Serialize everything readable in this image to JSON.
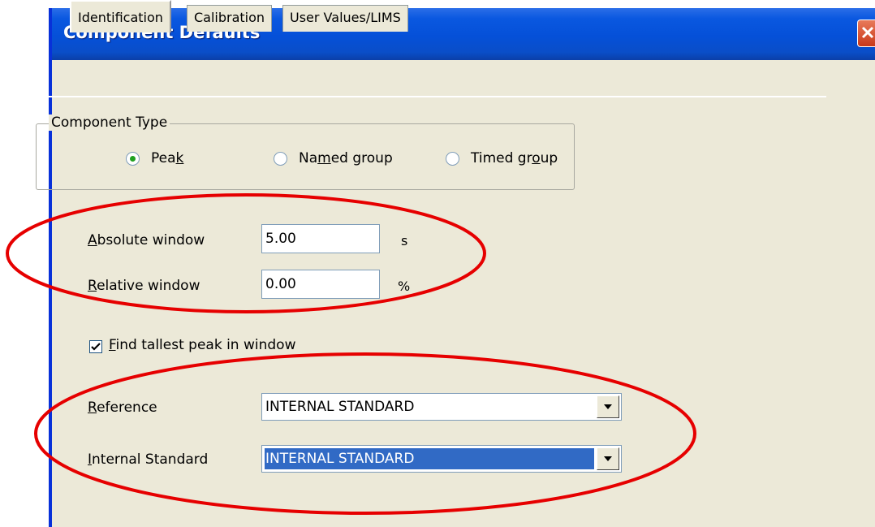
{
  "window": {
    "title": "Component Defaults"
  },
  "tabs": [
    {
      "label": "Identification",
      "active": true
    },
    {
      "label": "Calibration",
      "active": false
    },
    {
      "label": "User Values/LIMS",
      "active": false
    }
  ],
  "component_type": {
    "legend": "Component Type",
    "options": [
      {
        "pre": "Pea",
        "key": "k",
        "post": "",
        "selected": true
      },
      {
        "pre": "Na",
        "key": "m",
        "post": "ed group",
        "selected": false
      },
      {
        "pre": "Timed gr",
        "key": "o",
        "post": "up",
        "selected": false
      }
    ]
  },
  "absolute_window": {
    "key": "A",
    "rest": "bsolute  window",
    "value": "5.00",
    "unit": "s"
  },
  "relative_window": {
    "key": "R",
    "rest": "elative window",
    "value": "0.00",
    "unit": "%"
  },
  "find_tallest": {
    "key": "F",
    "rest": "ind tallest peak in window",
    "checked": true
  },
  "reference": {
    "key": "R",
    "rest": "eference",
    "value": "INTERNAL STANDARD"
  },
  "internal_standard": {
    "key": "I",
    "rest": "nternal Standard",
    "value": "INTERNAL STANDARD"
  },
  "colors": {
    "titlebar": "#0550d8",
    "annotation": "#e60000",
    "selection": "#316ac5",
    "dialog": "#ece9d8"
  }
}
